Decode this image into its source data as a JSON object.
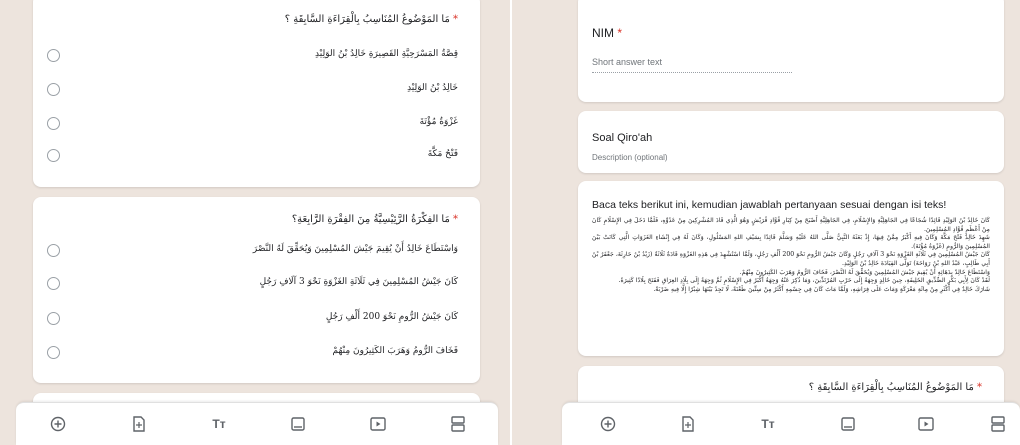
{
  "left": {
    "q1": {
      "title": "مَا المَوْضُوعُ المُنَاسِبُ بِالْقِرَاءَةِ السَّابِقَةِ ؟",
      "required_mark": "*",
      "options": [
        "قِصَّةُ المَسْرَحِيَّةِ القَصِيرَةِ خَالِدُ بْنُ الوَلِيْدِ",
        "خَالِدُ بْنُ الوَلِيْدِ",
        "غَزْوَةُ مُؤْتَةَ",
        "فَتْحُ مَكَّةَ"
      ]
    },
    "q2": {
      "title": "مَا الفِكْرَةُ الرَّئِيْسِيَّةُ مِنَ الفِقْرَةِ الرَّابِعَةِ؟",
      "required_mark": "*",
      "options": [
        "وَاسْتَطَاعَ خَالِدُ أَنْ يُقِيمَ جَيْشَ المُسْلِمِينَ وَيُحَقِّقَ لَهُ النَّصْرَ",
        "كَانَ جَيْشُ المُسْلِمِينَ فِي ثَلَاثَةِ الغَزْوَةِ نَحْوَ 3 آلَافِ رَجُلٍ",
        "كَانَ جَيْشُ الرُّومِ نَحْوَ 200 أَلْفِ رَجُلٍ",
        "فَخَافَ الرُّومُ وَهَرَبَ الكَثِيرُونَ مِنْهُمْ"
      ]
    }
  },
  "right": {
    "nim": {
      "label": "NIM",
      "required_mark": "*",
      "placeholder": "Short answer text"
    },
    "section": {
      "title": "Soal Qiro'ah",
      "description": "Description (optional)"
    },
    "reading": {
      "instruction": "Baca teks berikut ini, kemudian jawablah pertanyaan sesuai dengan isi teks!",
      "paragraphs": [
        "كَانَ خَالِدُ بْنُ الوَلِيْدِ قَائِدًا شُجَاعًا فِي الجَاهِلِيَّةِ وَالإِسْلَامِ، فِي الجَاهِلِيَّةِ أَصْبَحَ مِنْ كِبَارِ قُوَّادِ قُرَيْشٍ وَهُوَ الَّذِي قَادَ المُشْرِكِينَ مِنْ عَدُوِّهِ، فَلَمَّا دَخَلَ فِي الإِسْلَامِ كَانَ مِنْ أَعْظَمِ قُوَّادِ المُسْلِمِينَ.",
        "شَهِدَ خَالِدٌ فَتْحَ مَكَّةَ وَكَانَ فِيهِ أَكْبَرُ مِمَّنْ فِيهَا، إِذْ بَعَثَهُ النَّبِيُّ صَلَّى اللهُ عَلَيْهِ وَسَلَّمَ قَائِدًا بِسَيْفِ اللهِ المَسْلُولِ، وَكَانَ لَهُ فِي إِنْشَاءِ الغَزَوَاتِ الَّتِي كَانَتْ بَيْنَ المُسْلِمِينَ وَالرُّومِ (غَزْوَةُ مُؤْتَةَ).",
        "كَانَ جَيْشُ المُسْلِمِينَ فِي ثَلَاثَةِ الغَزْوَةِ نَحْوَ 3 آلَافِ رَجُلٍ وَكَانَ جَيْشُ الرُّومِ نَحْوَ 200 أَلْفِ رَجُلٍ، وَلَمَّا اسْتُشْهِدَ فِي هَذِهِ الغَزْوَةِ قَادَةٌ ثَلَاثَةٌ (زَيْدُ بْنُ حَارِثَةَ، جَعْفَرُ بْنُ أَبِي طَالِبٍ، عَبْدُ اللهِ بْنُ رَوَاحَةَ) تَوَلَّى القِيَادَةَ خَالِدُ بْنُ الوَلِيْدِ.",
        "وَاسْتَطَاعَ خَالِدٌ بِدَهَائِهِ أَنْ يُقِيمَ جَيْشَ المُسْلِمِينَ وَيُحَقِّقَ لَهُ النَّصْرَ، فَخَافَ الرُّومُ وَهَرَبَ الكَثِيرُونَ مِنْهُمْ.",
        "لَقَدْ كَانَ لِأَبِي بَكْرٍ الصِّدِّيقِ الخَلِيفَةِ، حِينَ خَالِدٍ وَجِهَةُ إِلَى حَرْبِ المُرْتَدِّينَ، وَمَا ذُكِرَ عَنْهُ وَجِهَةُ أَكْبَرُ فِي الإِسْلَامِ ثُمَّ وَجِهَةُ إِلَى بِلَادِ العِرَاقِ فَفَتَحَ بِلَادًا كَثِيرَةً.",
        "شَارَكَ خَالِدٌ فِي أَكْثَرِ مِنْ مِائَةِ مَعْرَكَةٍ وَمَاتَ عَلَى فِرَاشِهِ، وَلَمَّا مَاتَ كَانَ فِي جِسْمِهِ أَكْثَرُ مِنْ سِتِّينَ طَعْنَةً، لَا تَجِدُ بَيْنَهَا شِبْرًا إِلَّا فِيهِ ضَرْبَةٌ."
      ]
    },
    "q1_repeat": {
      "title": "مَا المَوْضُوعُ المُنَاسِبُ بِالْقِرَاءَةِ السَّابِقَةِ ؟",
      "required_mark": "*"
    }
  },
  "toolbar": {
    "tools": [
      {
        "name": "add-question-icon",
        "glyph": "⊕"
      },
      {
        "name": "import-questions-icon",
        "glyph": "⇪"
      },
      {
        "name": "add-title-icon",
        "glyph": "Tт"
      },
      {
        "name": "add-image-icon",
        "glyph": "▭"
      },
      {
        "name": "add-video-icon",
        "glyph": "▶"
      },
      {
        "name": "add-section-icon",
        "glyph": "☰"
      }
    ]
  },
  "colors": {
    "background": "#ede4dd",
    "card": "#ffffff",
    "required": "#d93025",
    "icon": "#5f6368"
  }
}
